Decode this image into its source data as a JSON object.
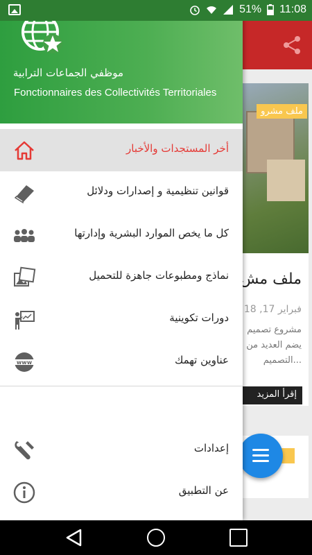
{
  "status_bar": {
    "battery": "51%",
    "time": "11:08"
  },
  "header": {
    "title_ar": "موظفي الجماعات الترابية",
    "title_fr": "Fonctionnaires des Collectivités Territoriales"
  },
  "menu": {
    "items": [
      {
        "label": "أخر المستجدات والأخبار",
        "icon": "home-icon"
      },
      {
        "label": "قوانين تنظيمية و إصدارات ودلائل",
        "icon": "book-icon"
      },
      {
        "label": "كل ما يخص الموارد البشرية وإدارتها",
        "icon": "people-icon"
      },
      {
        "label": "نماذج ومطبوعات جاهزة للتحميل",
        "icon": "images-icon"
      },
      {
        "label": "دورات تكوينية",
        "icon": "presentation-icon"
      },
      {
        "label": "عناوين تهمك",
        "icon": "www-icon"
      }
    ],
    "secondary": [
      {
        "label": "إعدادات",
        "icon": "wrench-icon"
      },
      {
        "label": "عن التطبيق",
        "icon": "info-icon"
      }
    ]
  },
  "background": {
    "card_badge": "ملف مشرو",
    "card_title": "ملف مش",
    "card_date": "فبراير 17, 18",
    "card_excerpt": "مشروع تصميم يضم العديد من التصميم...",
    "read_more": "إقرأ المزيد"
  },
  "colors": {
    "accent": "#e53935",
    "drawer_header": "#4caf50",
    "toolbar": "#c62828",
    "fab": "#1e88e5"
  }
}
